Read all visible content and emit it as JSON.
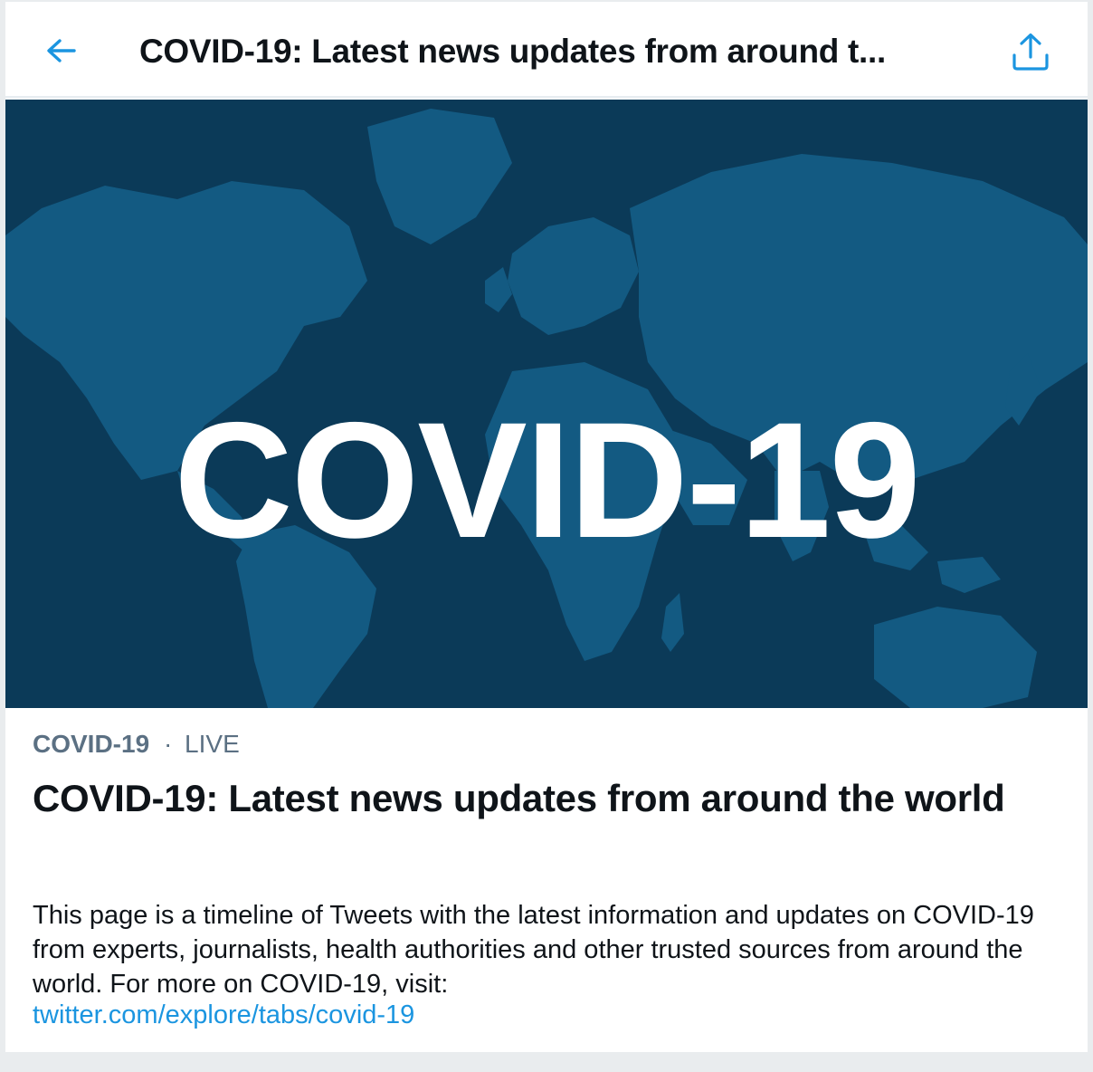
{
  "header": {
    "title": "COVID-19: Latest news updates from around t...",
    "back_icon": "arrow-left-icon",
    "share_icon": "share-icon",
    "accent_color": "#1b95e0"
  },
  "hero": {
    "text": "COVID-19",
    "background_color": "#0b3a58",
    "map_color": "#135a82"
  },
  "details": {
    "category": "COVID-19",
    "separator": "·",
    "status": "LIVE",
    "title": "COVID-19: Latest news updates from around the world",
    "description": "This page is a timeline of Tweets with the latest information and updates on COVID-19 from experts, journalists, health authorities and other trusted sources from around the world. For more on COVID-19, visit:",
    "link": "twitter.com/explore/tabs/covid-19"
  }
}
